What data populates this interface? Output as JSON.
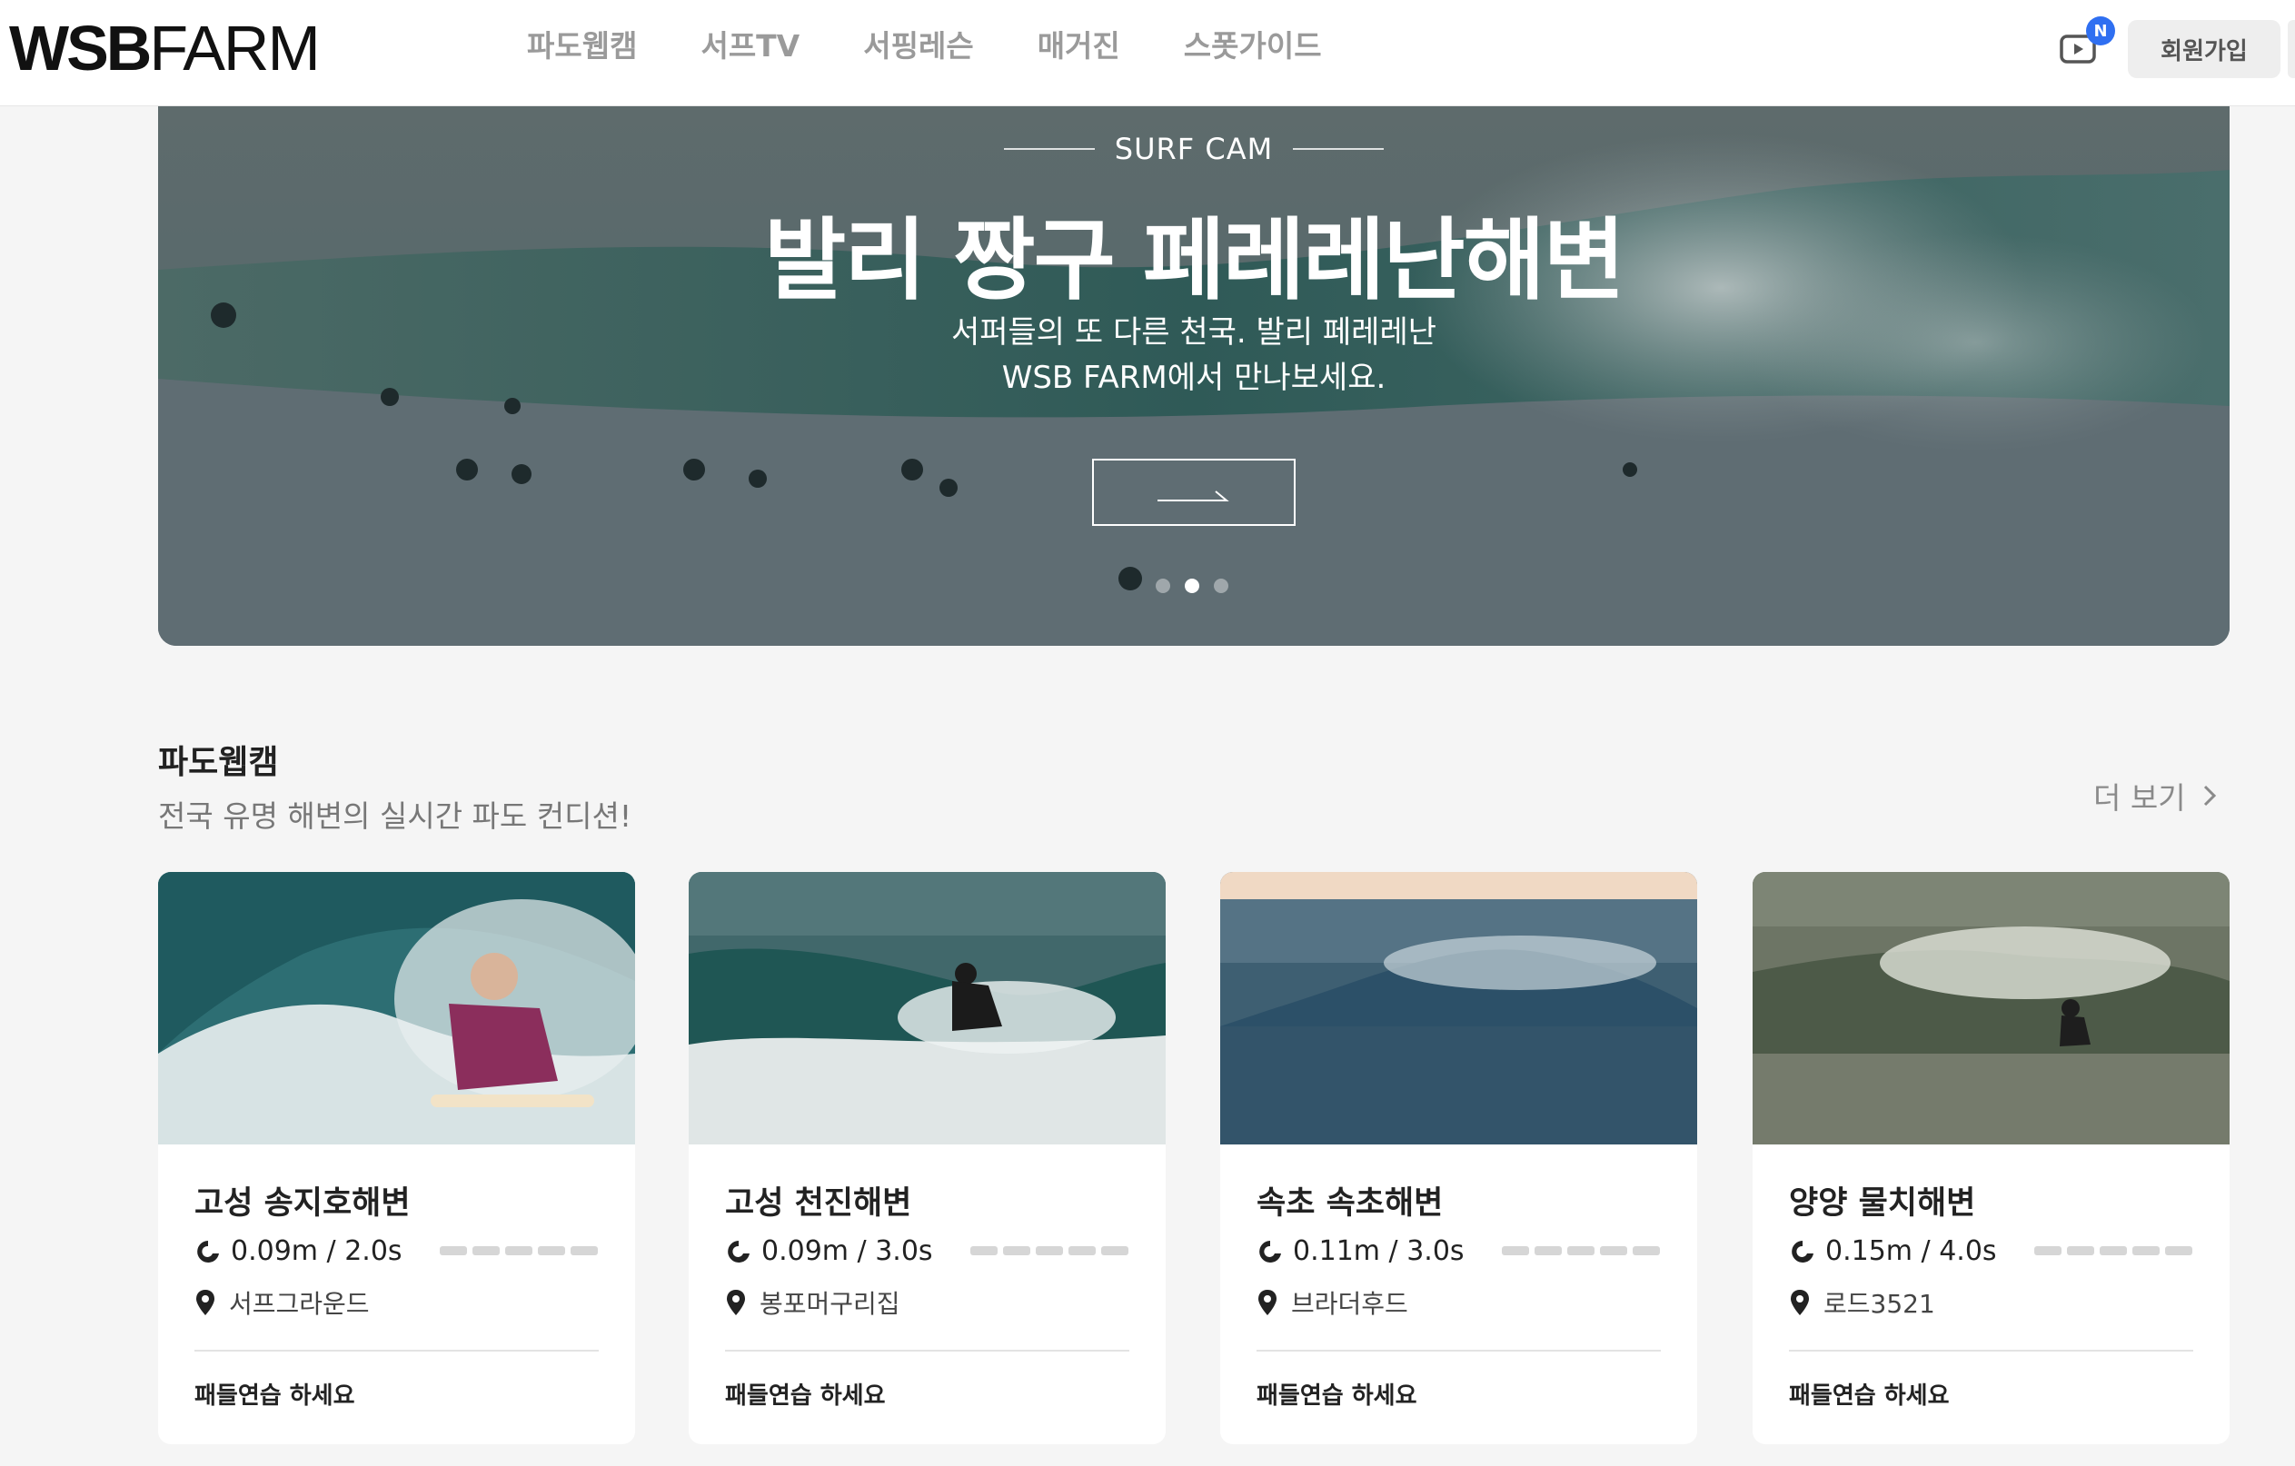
{
  "header": {
    "logo_text_bold": "WSB",
    "logo_text_thin": "FARM",
    "nav": [
      "파도웹캠",
      "서프TV",
      "서핑레슨",
      "매거진",
      "스폿가이드"
    ],
    "tv_badge": "N",
    "signup_label": "회원가입"
  },
  "hero": {
    "eyebrow": "SURF CAM",
    "title": "발리 짱구 페레레난해변",
    "desc_line1": "서퍼들의 또 다른 천국. 발리 페레레난",
    "desc_line2": "WSB FARM에서 만나보세요.",
    "active_dot": 0
  },
  "section": {
    "title": "파도웹캠",
    "subtitle": "전국 유명 해변의 실시간 파도 컨디션!",
    "more_label": "더 보기"
  },
  "cards": [
    {
      "name": "고성 송지호해변",
      "wave": "0.09m / 2.0s",
      "spot": "서프그라운드",
      "tip": "패들연습 하세요"
    },
    {
      "name": "고성 천진해변",
      "wave": "0.09m / 3.0s",
      "spot": "봉포머구리집",
      "tip": "패들연습 하세요"
    },
    {
      "name": "속초 속초해변",
      "wave": "0.11m / 3.0s",
      "spot": "브라더후드",
      "tip": "패들연습 하세요"
    },
    {
      "name": "양양 물치해변",
      "wave": "0.15m / 4.0s",
      "spot": "로드3521",
      "tip": "패들연습 하세요"
    }
  ],
  "colors": {
    "accent": "#2f6ff1",
    "page_bg": "#f5f5f5",
    "nav_text": "#9a9a9a"
  },
  "icons": [
    "play-tv-icon",
    "arrow-right-icon",
    "chevron-right-icon",
    "wave-icon",
    "location-pin-icon"
  ]
}
